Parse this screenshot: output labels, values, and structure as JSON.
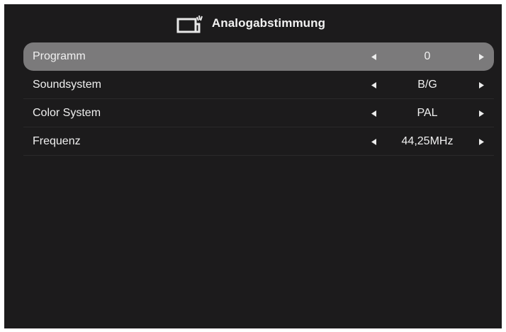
{
  "header": {
    "title": "Analogabstimmung",
    "icon": "tv-signal-icon"
  },
  "colors": {
    "background": "#1c1b1c",
    "selected_row": "#7b7a7b",
    "text": "#f0f0f0"
  },
  "menu": {
    "items": [
      {
        "label": "Programm",
        "value": "0",
        "selected": true
      },
      {
        "label": "Soundsystem",
        "value": "B/G",
        "selected": false
      },
      {
        "label": "Color System",
        "value": "PAL",
        "selected": false
      },
      {
        "label": "Frequenz",
        "value": "44,25MHz",
        "selected": false
      }
    ]
  }
}
